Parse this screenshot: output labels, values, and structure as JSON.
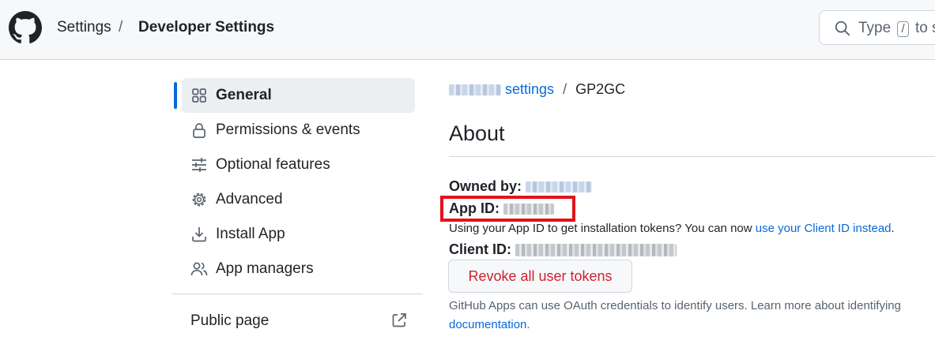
{
  "header": {
    "breadcrumb_settings": "Settings",
    "breadcrumb_separator": "/",
    "breadcrumb_current": "Developer Settings",
    "search": {
      "prefix": "Type",
      "key": "/",
      "suffix": "to s"
    }
  },
  "sidebar": {
    "items": [
      {
        "label": "General",
        "icon": "apps-icon",
        "active": true
      },
      {
        "label": "Permissions & events",
        "icon": "lock-icon"
      },
      {
        "label": "Optional features",
        "icon": "sliders-icon"
      },
      {
        "label": "Advanced",
        "icon": "gear-icon"
      },
      {
        "label": "Install App",
        "icon": "download-icon"
      },
      {
        "label": "App managers",
        "icon": "people-icon"
      }
    ],
    "public_page": "Public page"
  },
  "main": {
    "breadcrumb": {
      "link": "settings",
      "separator": "/",
      "current": "GP2GC"
    },
    "title": "About",
    "owned_by_label": "Owned by:",
    "app_id_label": "App ID:",
    "note_text": "Using your App ID to get installation tokens? You can now",
    "note_link": "use your Client ID instead",
    "note_end": ".",
    "client_id_label": "Client ID:",
    "revoke_button": "Revoke all user tokens",
    "oauth_note": "GitHub Apps can use OAuth credentials to identify users. Learn more about identifying",
    "doc_link": "documentation",
    "doc_end": "."
  },
  "colors": {
    "accent": "#0969da",
    "danger": "#cf222e",
    "highlight_box": "#e3121b"
  }
}
